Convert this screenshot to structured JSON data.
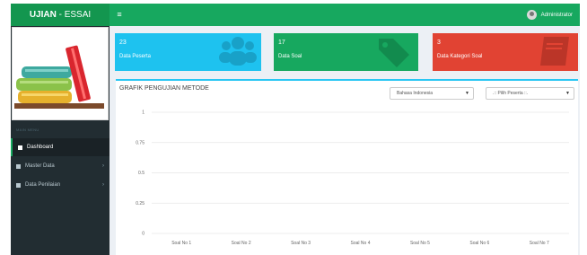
{
  "header": {
    "brand_bold": "UJIAN",
    "brand_rest": " - ESSAI",
    "menu_icon": "hamburger-icon",
    "user_name": "Administrator"
  },
  "sidebar": {
    "header": "MAIN MENU",
    "items": [
      {
        "label": "Dashboard",
        "icon": "home-icon",
        "active": true
      },
      {
        "label": "Master Data",
        "icon": "table-icon",
        "chevron": "›"
      },
      {
        "label": "Data Penilaian",
        "icon": "table-icon",
        "chevron": "›"
      }
    ]
  },
  "info_boxes": [
    {
      "count": "23",
      "label": "Data Peserta",
      "color": "#1ec2ef",
      "icon": "users-icon"
    },
    {
      "count": "17",
      "label": "Data Soal",
      "color": "#17a85f",
      "icon": "tags-icon"
    },
    {
      "count": "3",
      "label": "Data Kategori Soal",
      "color": "#e14333",
      "icon": "book-icon"
    }
  ],
  "chart_panel": {
    "title": "GRAFIK PENGUJIAN METODE",
    "language_select": "Bahasa Indonesia",
    "participant_select": ".:: Pilih Peserta ::."
  },
  "chart_data": {
    "type": "line",
    "title": "GRAFIK PENGUJIAN METODE",
    "categories": [
      "Soal No 1",
      "Soal No 2",
      "Soal No 3",
      "Soal No 4",
      "Soal No 5",
      "Soal No 6",
      "Soal No 7"
    ],
    "series": [],
    "yticks": [
      "1",
      "0.75",
      "0.5",
      "0.25",
      "0"
    ],
    "ylim": [
      0,
      1
    ],
    "grid": true
  },
  "colors": {
    "header": "#17a85f",
    "sidebar": "#222d32",
    "accent_blue": "#1ec2ef",
    "accent_green": "#17a85f",
    "accent_red": "#e14333"
  }
}
